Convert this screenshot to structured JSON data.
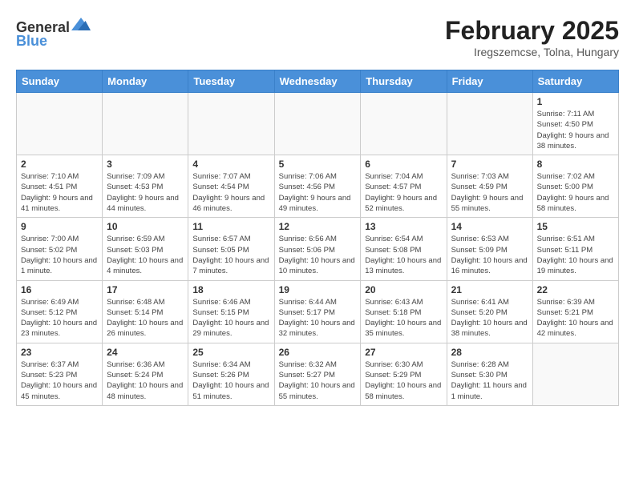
{
  "header": {
    "logo_line1": "General",
    "logo_line2": "Blue",
    "title": "February 2025",
    "subtitle": "Iregszemcse, Tolna, Hungary"
  },
  "days_of_week": [
    "Sunday",
    "Monday",
    "Tuesday",
    "Wednesday",
    "Thursday",
    "Friday",
    "Saturday"
  ],
  "weeks": [
    [
      {
        "day": "",
        "info": ""
      },
      {
        "day": "",
        "info": ""
      },
      {
        "day": "",
        "info": ""
      },
      {
        "day": "",
        "info": ""
      },
      {
        "day": "",
        "info": ""
      },
      {
        "day": "",
        "info": ""
      },
      {
        "day": "1",
        "info": "Sunrise: 7:11 AM\nSunset: 4:50 PM\nDaylight: 9 hours and 38 minutes."
      }
    ],
    [
      {
        "day": "2",
        "info": "Sunrise: 7:10 AM\nSunset: 4:51 PM\nDaylight: 9 hours and 41 minutes."
      },
      {
        "day": "3",
        "info": "Sunrise: 7:09 AM\nSunset: 4:53 PM\nDaylight: 9 hours and 44 minutes."
      },
      {
        "day": "4",
        "info": "Sunrise: 7:07 AM\nSunset: 4:54 PM\nDaylight: 9 hours and 46 minutes."
      },
      {
        "day": "5",
        "info": "Sunrise: 7:06 AM\nSunset: 4:56 PM\nDaylight: 9 hours and 49 minutes."
      },
      {
        "day": "6",
        "info": "Sunrise: 7:04 AM\nSunset: 4:57 PM\nDaylight: 9 hours and 52 minutes."
      },
      {
        "day": "7",
        "info": "Sunrise: 7:03 AM\nSunset: 4:59 PM\nDaylight: 9 hours and 55 minutes."
      },
      {
        "day": "8",
        "info": "Sunrise: 7:02 AM\nSunset: 5:00 PM\nDaylight: 9 hours and 58 minutes."
      }
    ],
    [
      {
        "day": "9",
        "info": "Sunrise: 7:00 AM\nSunset: 5:02 PM\nDaylight: 10 hours and 1 minute."
      },
      {
        "day": "10",
        "info": "Sunrise: 6:59 AM\nSunset: 5:03 PM\nDaylight: 10 hours and 4 minutes."
      },
      {
        "day": "11",
        "info": "Sunrise: 6:57 AM\nSunset: 5:05 PM\nDaylight: 10 hours and 7 minutes."
      },
      {
        "day": "12",
        "info": "Sunrise: 6:56 AM\nSunset: 5:06 PM\nDaylight: 10 hours and 10 minutes."
      },
      {
        "day": "13",
        "info": "Sunrise: 6:54 AM\nSunset: 5:08 PM\nDaylight: 10 hours and 13 minutes."
      },
      {
        "day": "14",
        "info": "Sunrise: 6:53 AM\nSunset: 5:09 PM\nDaylight: 10 hours and 16 minutes."
      },
      {
        "day": "15",
        "info": "Sunrise: 6:51 AM\nSunset: 5:11 PM\nDaylight: 10 hours and 19 minutes."
      }
    ],
    [
      {
        "day": "16",
        "info": "Sunrise: 6:49 AM\nSunset: 5:12 PM\nDaylight: 10 hours and 23 minutes."
      },
      {
        "day": "17",
        "info": "Sunrise: 6:48 AM\nSunset: 5:14 PM\nDaylight: 10 hours and 26 minutes."
      },
      {
        "day": "18",
        "info": "Sunrise: 6:46 AM\nSunset: 5:15 PM\nDaylight: 10 hours and 29 minutes."
      },
      {
        "day": "19",
        "info": "Sunrise: 6:44 AM\nSunset: 5:17 PM\nDaylight: 10 hours and 32 minutes."
      },
      {
        "day": "20",
        "info": "Sunrise: 6:43 AM\nSunset: 5:18 PM\nDaylight: 10 hours and 35 minutes."
      },
      {
        "day": "21",
        "info": "Sunrise: 6:41 AM\nSunset: 5:20 PM\nDaylight: 10 hours and 38 minutes."
      },
      {
        "day": "22",
        "info": "Sunrise: 6:39 AM\nSunset: 5:21 PM\nDaylight: 10 hours and 42 minutes."
      }
    ],
    [
      {
        "day": "23",
        "info": "Sunrise: 6:37 AM\nSunset: 5:23 PM\nDaylight: 10 hours and 45 minutes."
      },
      {
        "day": "24",
        "info": "Sunrise: 6:36 AM\nSunset: 5:24 PM\nDaylight: 10 hours and 48 minutes."
      },
      {
        "day": "25",
        "info": "Sunrise: 6:34 AM\nSunset: 5:26 PM\nDaylight: 10 hours and 51 minutes."
      },
      {
        "day": "26",
        "info": "Sunrise: 6:32 AM\nSunset: 5:27 PM\nDaylight: 10 hours and 55 minutes."
      },
      {
        "day": "27",
        "info": "Sunrise: 6:30 AM\nSunset: 5:29 PM\nDaylight: 10 hours and 58 minutes."
      },
      {
        "day": "28",
        "info": "Sunrise: 6:28 AM\nSunset: 5:30 PM\nDaylight: 11 hours and 1 minute."
      },
      {
        "day": "",
        "info": ""
      }
    ]
  ]
}
